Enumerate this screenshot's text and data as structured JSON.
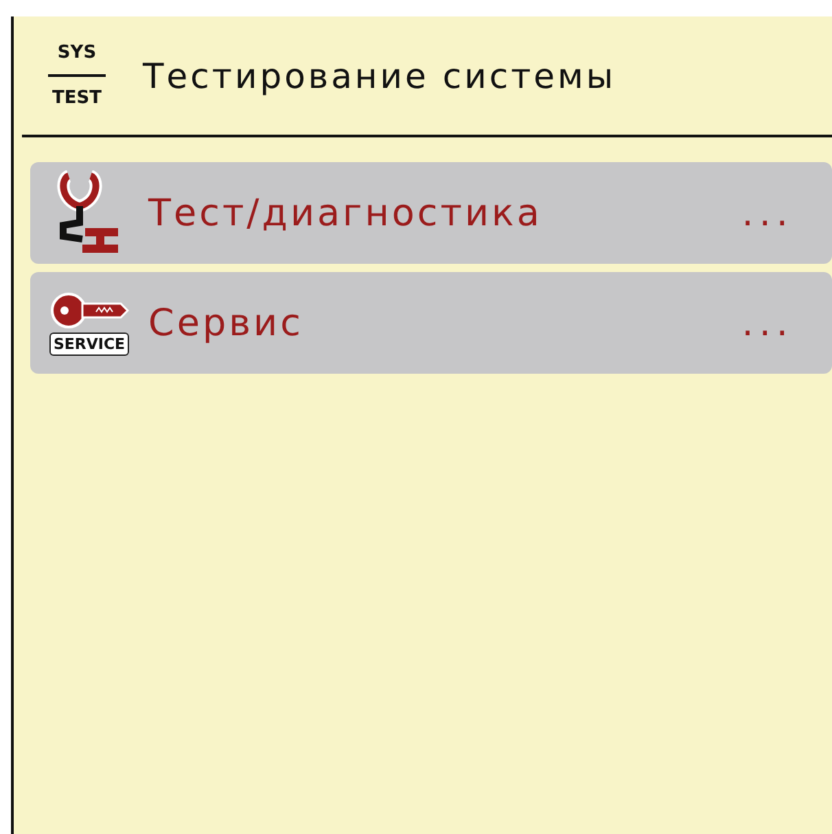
{
  "header": {
    "icon_top": "SYS",
    "icon_bottom": "TEST",
    "title": "Тестирование системы"
  },
  "menu_items": [
    {
      "kind": "diagnostics",
      "label": "Тест/диагностика",
      "more": "..."
    },
    {
      "kind": "service",
      "icon_label": "SERVICE",
      "label": "Сервис",
      "more": "..."
    }
  ]
}
